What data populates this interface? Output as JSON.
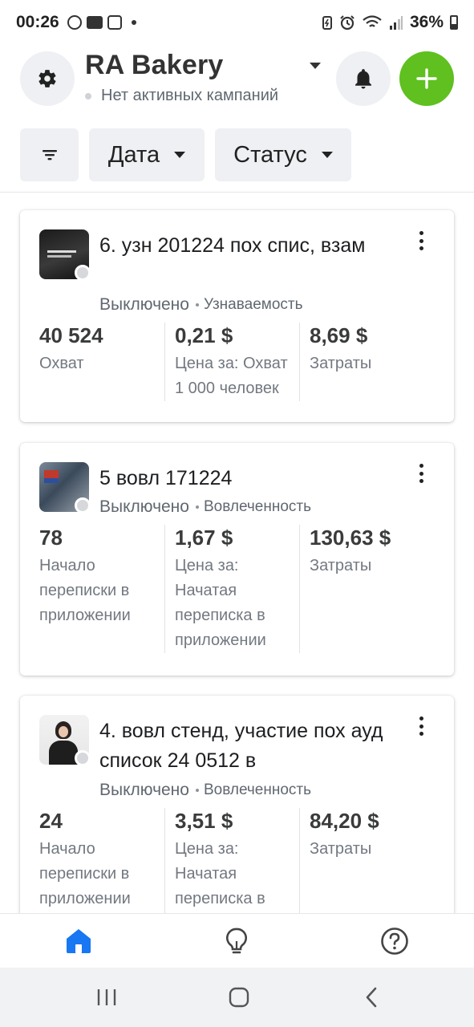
{
  "status_bar": {
    "time": "00:26",
    "battery": "36%"
  },
  "header": {
    "title": "RA Bakery",
    "subtitle": "Нет активных кампаний",
    "accent_color": "#5fc01f"
  },
  "filters": {
    "date_label": "Дата",
    "status_label": "Статус"
  },
  "campaigns": [
    {
      "name": "6. узн 201224 пох спис, взам",
      "status": "Выключено",
      "objective": "Узнаваемость",
      "metrics": [
        {
          "value": "40 524",
          "label": "Охват"
        },
        {
          "value": "0,21 $",
          "label": "Цена за: Охват 1 000 человек"
        },
        {
          "value": "8,69 $",
          "label": "Затраты"
        }
      ]
    },
    {
      "name": "5 вовл 171224",
      "status": "Выключено",
      "objective": "Вовлеченность",
      "metrics": [
        {
          "value": "78",
          "label": "Начало переписки в приложении"
        },
        {
          "value": "1,67 $",
          "label": "Цена за: Начатая переписка в приложении"
        },
        {
          "value": "130,63 $",
          "label": "Затраты"
        }
      ]
    },
    {
      "name": "4. вовл стенд, участие пох ауд список 24 0512 в",
      "status": "Выключено",
      "objective": "Вовлеченность",
      "metrics": [
        {
          "value": "24",
          "label": "Начало переписки в приложении"
        },
        {
          "value": "3,51 $",
          "label": "Цена за: Начатая переписка в приложении"
        },
        {
          "value": "84,20 $",
          "label": "Затраты"
        }
      ]
    }
  ],
  "bottom_nav": {
    "active_color": "#1877f2"
  }
}
